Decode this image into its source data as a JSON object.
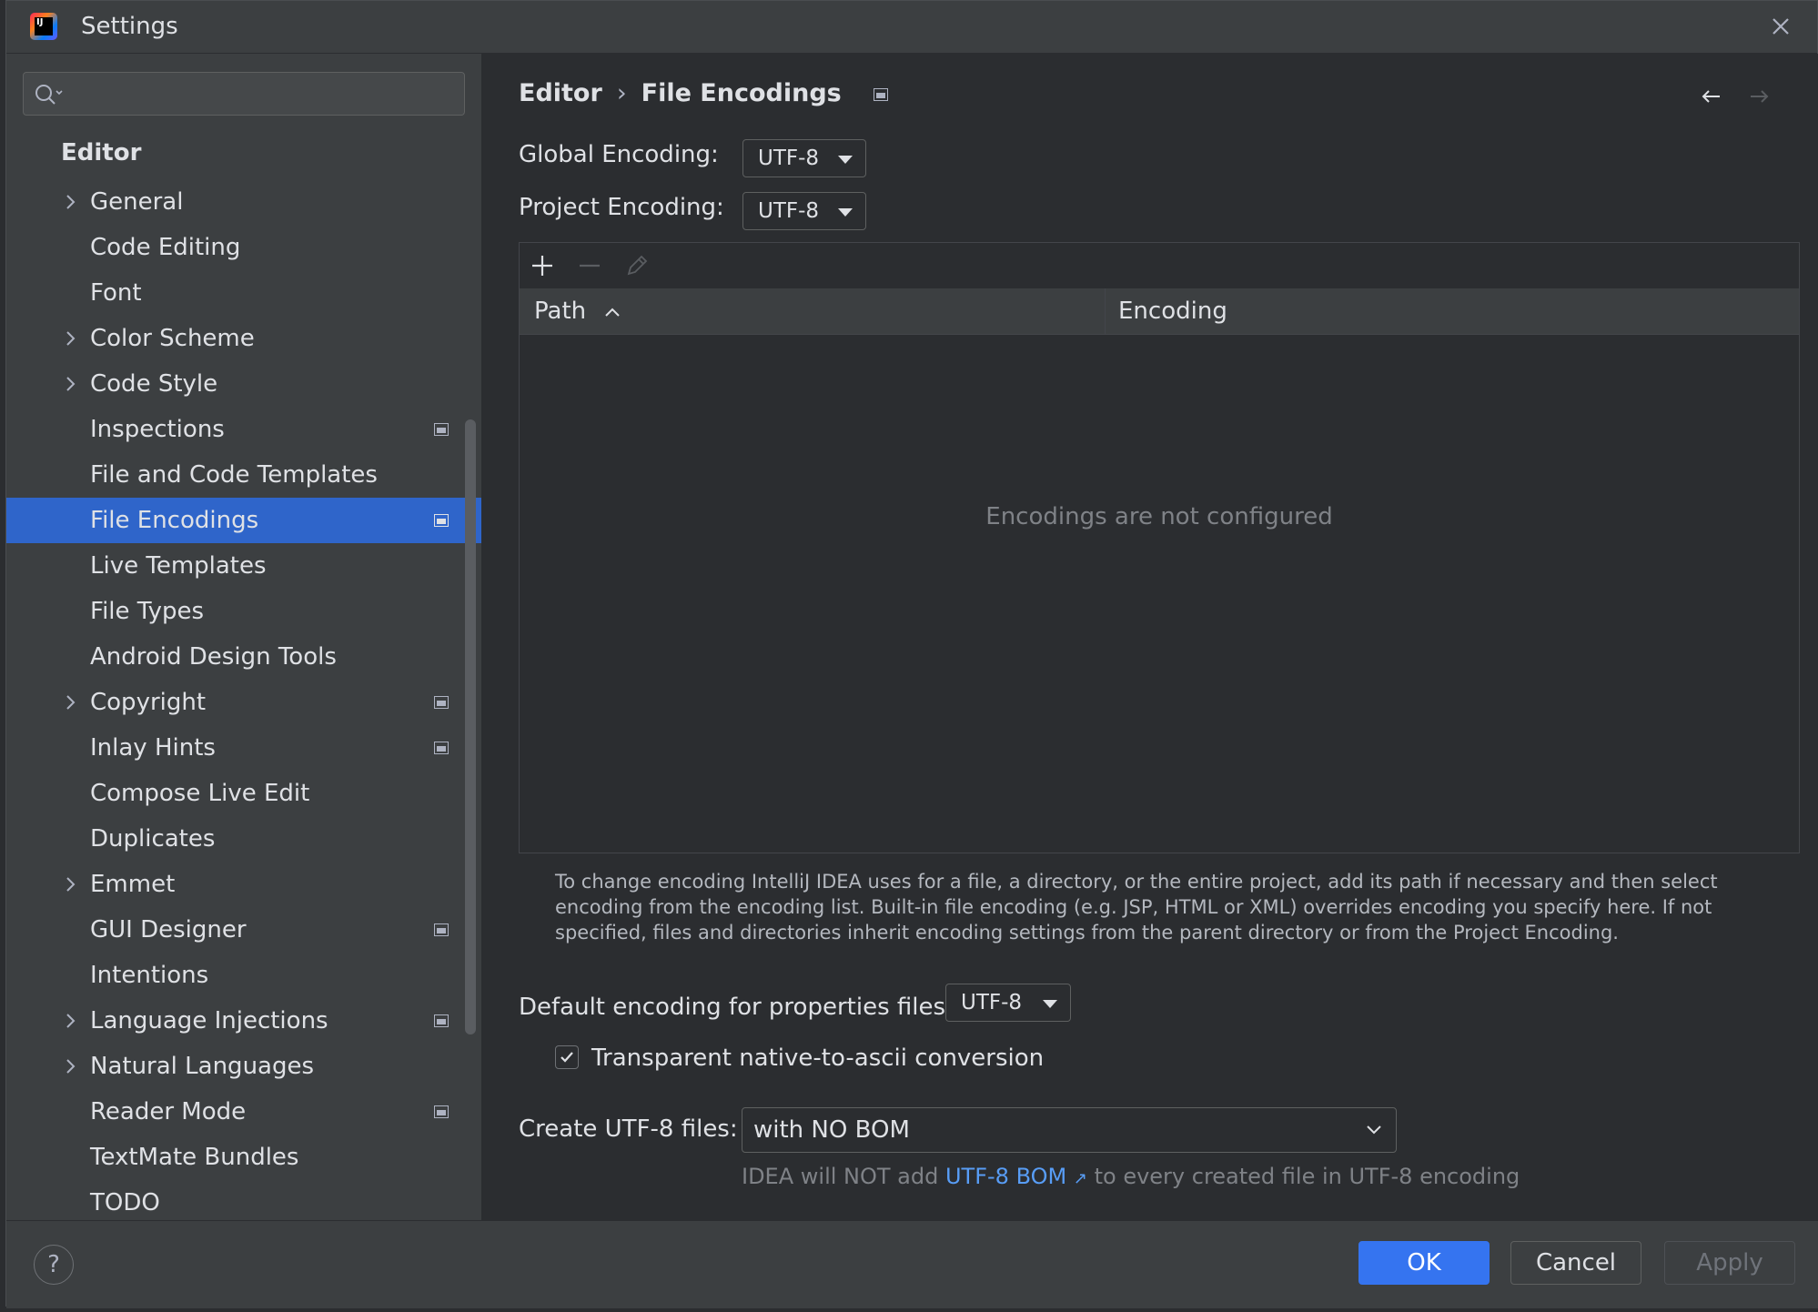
{
  "window": {
    "title": "Settings"
  },
  "search": {
    "placeholder": ""
  },
  "sidebar": {
    "section_title": "Editor",
    "items": [
      {
        "label": "General",
        "has_chevron": true,
        "has_badge": false,
        "selected": false
      },
      {
        "label": "Code Editing",
        "has_chevron": false,
        "has_badge": false,
        "selected": false
      },
      {
        "label": "Font",
        "has_chevron": false,
        "has_badge": false,
        "selected": false
      },
      {
        "label": "Color Scheme",
        "has_chevron": true,
        "has_badge": false,
        "selected": false
      },
      {
        "label": "Code Style",
        "has_chevron": true,
        "has_badge": false,
        "selected": false
      },
      {
        "label": "Inspections",
        "has_chevron": false,
        "has_badge": true,
        "selected": false
      },
      {
        "label": "File and Code Templates",
        "has_chevron": false,
        "has_badge": false,
        "selected": false
      },
      {
        "label": "File Encodings",
        "has_chevron": false,
        "has_badge": true,
        "selected": true
      },
      {
        "label": "Live Templates",
        "has_chevron": false,
        "has_badge": false,
        "selected": false
      },
      {
        "label": "File Types",
        "has_chevron": false,
        "has_badge": false,
        "selected": false
      },
      {
        "label": "Android Design Tools",
        "has_chevron": false,
        "has_badge": false,
        "selected": false
      },
      {
        "label": "Copyright",
        "has_chevron": true,
        "has_badge": true,
        "selected": false
      },
      {
        "label": "Inlay Hints",
        "has_chevron": false,
        "has_badge": true,
        "selected": false
      },
      {
        "label": "Compose Live Edit",
        "has_chevron": false,
        "has_badge": false,
        "selected": false
      },
      {
        "label": "Duplicates",
        "has_chevron": false,
        "has_badge": false,
        "selected": false
      },
      {
        "label": "Emmet",
        "has_chevron": true,
        "has_badge": false,
        "selected": false
      },
      {
        "label": "GUI Designer",
        "has_chevron": false,
        "has_badge": true,
        "selected": false
      },
      {
        "label": "Intentions",
        "has_chevron": false,
        "has_badge": false,
        "selected": false
      },
      {
        "label": "Language Injections",
        "has_chevron": true,
        "has_badge": true,
        "selected": false
      },
      {
        "label": "Natural Languages",
        "has_chevron": true,
        "has_badge": false,
        "selected": false
      },
      {
        "label": "Reader Mode",
        "has_chevron": false,
        "has_badge": true,
        "selected": false
      },
      {
        "label": "TextMate Bundles",
        "has_chevron": false,
        "has_badge": false,
        "selected": false
      },
      {
        "label": "TODO",
        "has_chevron": false,
        "has_badge": false,
        "selected": false
      }
    ]
  },
  "main": {
    "breadcrumb": {
      "parent": "Editor",
      "separator": "›",
      "current": "File Encodings"
    },
    "global_encoding": {
      "label": "Global Encoding:",
      "value": "UTF-8"
    },
    "project_encoding": {
      "label": "Project Encoding:",
      "value": "UTF-8"
    },
    "table": {
      "columns": [
        {
          "label": "Path",
          "sorted": "ascending"
        },
        {
          "label": "Encoding"
        }
      ],
      "empty_message": "Encodings are not configured"
    },
    "help_text": "To change encoding IntelliJ IDEA uses for a file, a directory, or the entire project, add its path if necessary and then select encoding from the encoding list. Built-in file encoding (e.g. JSP, HTML or XML) overrides encoding you specify here. If not specified, files and directories inherit encoding settings from the parent directory or from the Project Encoding.",
    "properties_encoding": {
      "label": "Default encoding for properties files:",
      "value": "UTF-8"
    },
    "native_to_ascii": {
      "label": "Transparent native-to-ascii conversion",
      "checked": true
    },
    "utf8_files": {
      "label": "Create UTF-8 files:",
      "value": "with NO BOM",
      "note_prefix": "IDEA will NOT add",
      "note_link": "UTF-8 BOM",
      "note_link_arrow": "↗",
      "note_suffix": "to every created file in UTF-8 encoding"
    }
  },
  "footer": {
    "help_label": "?",
    "ok_label": "OK",
    "cancel_label": "Cancel",
    "apply_label": "Apply"
  },
  "colors": {
    "accent": "#3574f0",
    "selection": "#2f65ca",
    "link": "#589df6",
    "panel": "#3c3f41",
    "content": "#2b2d30"
  }
}
